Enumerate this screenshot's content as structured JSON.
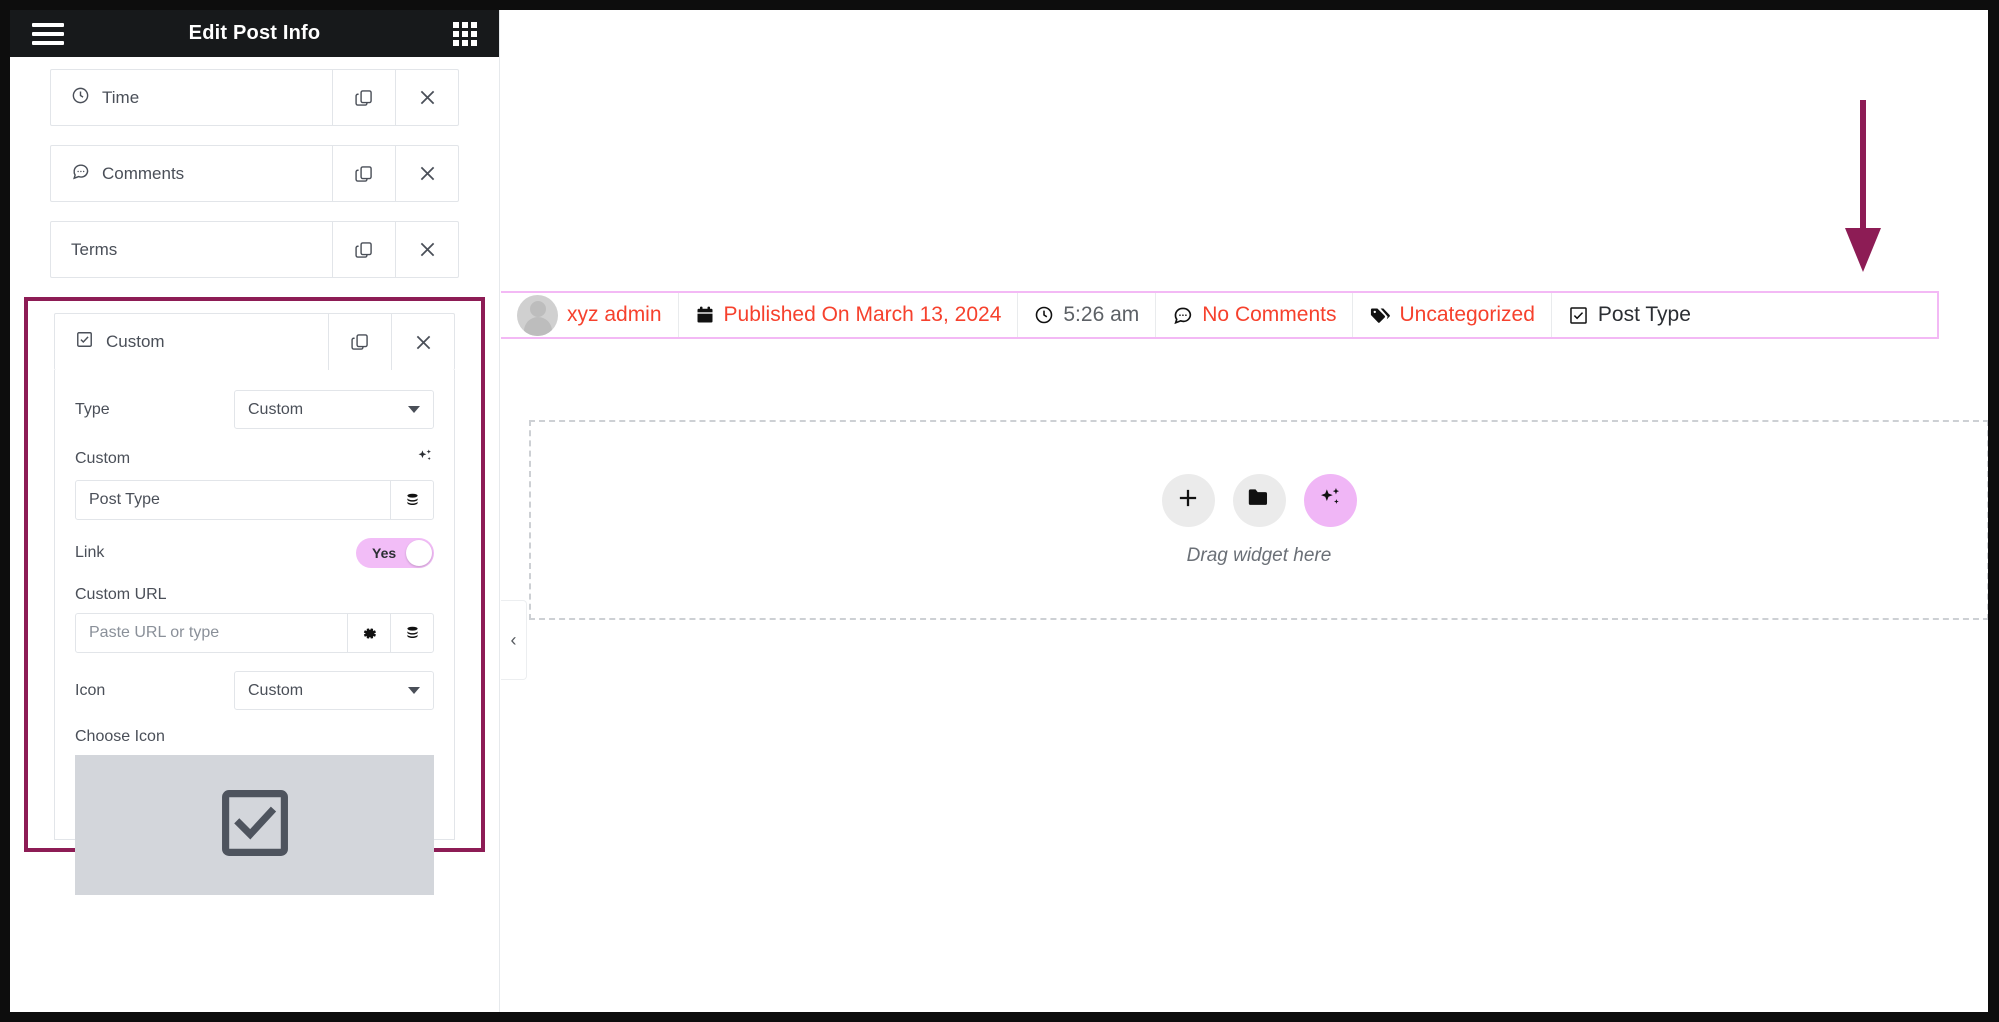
{
  "panel": {
    "header": {
      "menu_icon": "hamburger-menu-icon",
      "title": "Edit Post Info",
      "apps_icon": "apps-grid-icon"
    },
    "repeater_items": [
      {
        "label": "Time",
        "icon": "clock-icon",
        "duplicate_icon": "copy-icon",
        "remove_icon": "close-x-icon"
      },
      {
        "label": "Comments",
        "icon": "comment-icon",
        "duplicate_icon": "copy-icon",
        "remove_icon": "close-x-icon"
      },
      {
        "label": "Terms",
        "icon": "none",
        "duplicate_icon": "copy-icon",
        "remove_icon": "close-x-icon"
      }
    ],
    "custom_item": {
      "label": "Custom",
      "icon": "checkbox-checked-icon",
      "duplicate_icon": "copy-icon",
      "remove_icon": "close-x-icon",
      "highlight_color": "#8d1c55"
    },
    "fields": {
      "type_label": "Type",
      "type_value": "Custom",
      "custom_label": "Custom",
      "custom_ai_icon": "sparkle-ai-icon",
      "custom_value": "Post Type",
      "custom_dynamic_icon": "database-stack-icon",
      "link_label": "Link",
      "link_toggle_value": "Yes",
      "link_toggle_color": "#f2bdf7",
      "custom_url_label": "Custom URL",
      "custom_url_value": "",
      "custom_url_placeholder": "Paste URL or type",
      "custom_url_settings_icon": "gear-icon",
      "custom_url_dynamic_icon": "database-stack-icon",
      "icon_label": "Icon",
      "icon_value": "Custom",
      "choose_icon_label": "Choose Icon",
      "chosen_icon": "checkbox-checked-icon"
    }
  },
  "preview": {
    "collapse_handle_icon": "chevron-left-icon",
    "annotation_arrow": {
      "icon": "down-arrow-annotation",
      "color": "#8d1c55"
    },
    "post_info": {
      "border_color": "#f3b9f5",
      "items": [
        {
          "label": "xyz admin",
          "icon": "avatar-icon",
          "color": "#f6412d"
        },
        {
          "label": "Published On March 13, 2024",
          "icon": "calendar-icon",
          "color": "#f6412d"
        },
        {
          "label": "5:26 am",
          "icon": "clock-icon",
          "color": "#5d6166"
        },
        {
          "label": "No Comments",
          "icon": "comment-icon",
          "color": "#f6412d"
        },
        {
          "label": "Uncategorized",
          "icon": "tag-icon",
          "color": "#f6412d"
        },
        {
          "label": "Post Type",
          "icon": "checkbox-checked-icon",
          "color": "#2b2e33"
        }
      ]
    },
    "dropzone": {
      "label": "Drag widget here",
      "buttons": [
        {
          "icon": "plus-icon",
          "name": "add-element-button"
        },
        {
          "icon": "folder-icon",
          "name": "open-template-button"
        },
        {
          "icon": "sparkle-ai-icon",
          "name": "ai-generate-button"
        }
      ]
    }
  }
}
